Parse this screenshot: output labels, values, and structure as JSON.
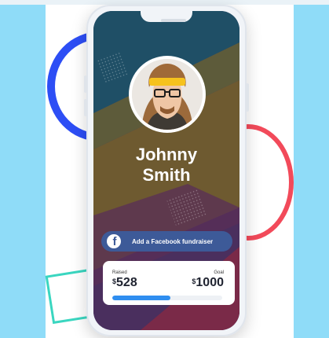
{
  "profile": {
    "first_name": "Johnny",
    "last_name": "Smith"
  },
  "facebook": {
    "button_label": "Add a Facebook fundraiser",
    "icon_glyph": "f"
  },
  "fundraiser": {
    "raised_label": "Raised",
    "raised_currency": "$",
    "raised_amount": "528",
    "goal_label": "Goal",
    "goal_currency": "$",
    "goal_amount": "1000",
    "progress_fraction": 0.528
  },
  "colors": {
    "facebook_blue": "#3d5a98",
    "progress_blue": "#2f8ef0",
    "side_panel": "#8fdcf8",
    "ring_blue": "#2d4ef5",
    "arc_red": "#f24a5a",
    "square_teal": "#3ad6c0"
  }
}
